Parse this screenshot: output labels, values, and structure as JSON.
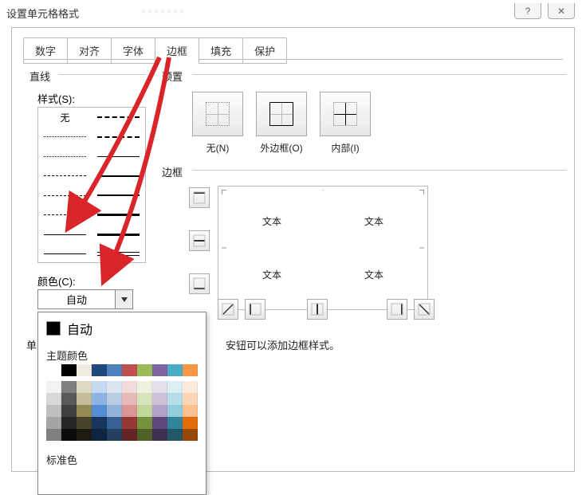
{
  "title": "设置单元格格式",
  "help_btn": "?",
  "close_btn": "✕",
  "tabs": {
    "num": "数字",
    "align": "对齐",
    "font": "字体",
    "border": "边框",
    "fill": "填充",
    "protect": "保护"
  },
  "line": {
    "group": "直线",
    "style_label": "样式(S):",
    "none": "无",
    "color_label": "颜色(C):",
    "color_value": "自动"
  },
  "preset": {
    "group": "预置",
    "none": "无(N)",
    "outer": "外边框(O)",
    "inner": "内部(I)"
  },
  "border_group": "边框",
  "preview_text": "文本",
  "hint": "安钮可以添加边框样式。",
  "hint_left_char": "单",
  "dropdown": {
    "auto": "自动",
    "theme": "主题颜色",
    "std": "标准色"
  },
  "palette": {
    "row0": [
      "#ffffff",
      "#000000",
      "#eeece1",
      "#1f497d",
      "#4f81bd",
      "#c0504d",
      "#9bbb59",
      "#8064a2",
      "#4bacc6",
      "#f79646"
    ],
    "rows": [
      [
        "#f2f2f2",
        "#7f7f7f",
        "#ddd9c3",
        "#c6d9f0",
        "#dbe5f1",
        "#f2dcdb",
        "#ebf1dd",
        "#e5e0ec",
        "#dbeef3",
        "#fdeada"
      ],
      [
        "#d8d8d8",
        "#595959",
        "#c4bd97",
        "#8db3e2",
        "#b8cce4",
        "#e5b9b7",
        "#d7e3bc",
        "#ccc1d9",
        "#b7dde8",
        "#fbd5b5"
      ],
      [
        "#bfbfbf",
        "#3f3f3f",
        "#938953",
        "#548dd4",
        "#95b3d7",
        "#d99694",
        "#c3d69b",
        "#b2a2c7",
        "#92cddc",
        "#fac08f"
      ],
      [
        "#a5a5a5",
        "#262626",
        "#494429",
        "#17365d",
        "#366092",
        "#953734",
        "#76923c",
        "#5f497a",
        "#31859b",
        "#e36c09"
      ],
      [
        "#7f7f7f",
        "#0c0c0c",
        "#1d1b10",
        "#0f243e",
        "#244061",
        "#632423",
        "#4f6128",
        "#3f3151",
        "#205867",
        "#974806"
      ]
    ]
  },
  "arrow_color": "#d9252a"
}
